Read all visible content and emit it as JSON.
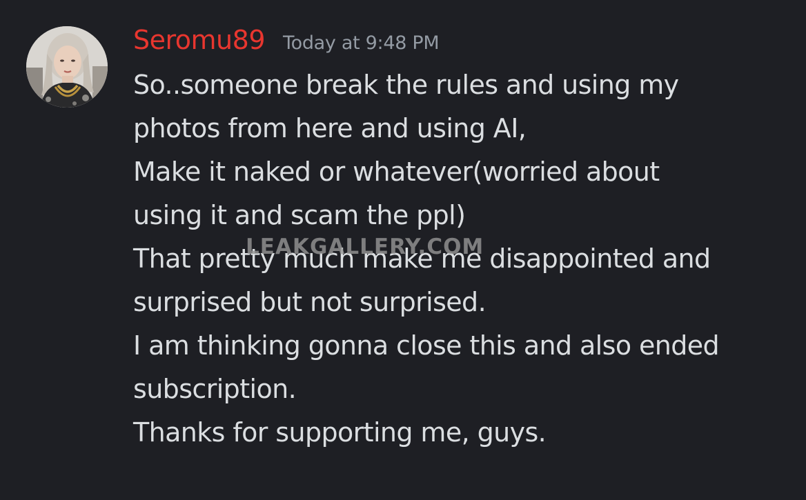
{
  "message": {
    "author": {
      "username": "Seromu89",
      "name_color": "#e8362f"
    },
    "timestamp": "Today at 9:48 PM",
    "lines": [
      "So..someone break the rules and using my",
      "photos from here and using AI,",
      "Make it naked or whatever(worried about",
      "using it and scam the ppl)",
      "That pretty much make me disappointed and",
      "surprised but not surprised.",
      "I am thinking gonna close this and also ended",
      "subscription.",
      "Thanks for supporting me, guys."
    ]
  },
  "watermark": "LEAKGALLERY.COM",
  "colors": {
    "background": "#1e1f24",
    "text": "#dbdee1",
    "muted": "#949ba4"
  }
}
